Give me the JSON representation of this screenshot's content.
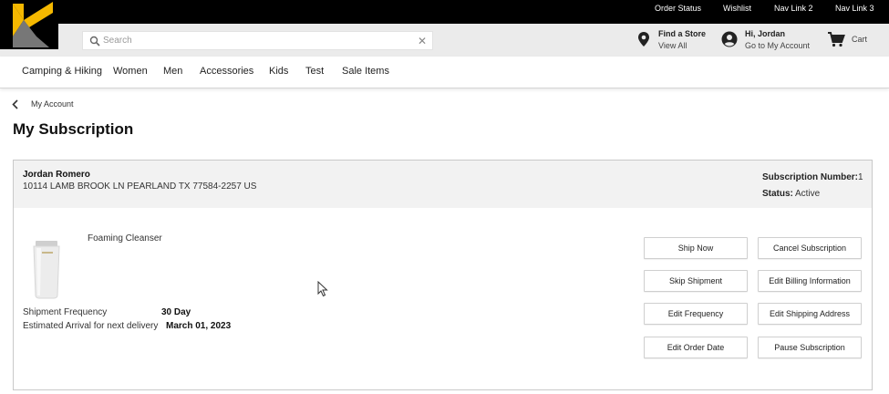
{
  "topnav": {
    "links": [
      "Order Status",
      "Wishlist",
      "Nav Link 2",
      "Nav Link 3"
    ]
  },
  "brand": {
    "colors": {
      "accent": "#f5b800",
      "logo_gray": "#777777",
      "topbar": "#000000",
      "header_bg": "#ebebeb"
    }
  },
  "search": {
    "placeholder": "Search",
    "value": "",
    "icon": "search-icon",
    "clear_icon": "close-icon",
    "clear_glyph": "✕"
  },
  "header": {
    "store": {
      "title": "Find a Store",
      "subtitle": "View All",
      "icon": "location-pin-icon"
    },
    "account": {
      "title": "Hi, Jordan",
      "subtitle": "Go to My Account",
      "icon": "user-icon"
    },
    "cart": {
      "label": "Cart",
      "icon": "cart-icon"
    }
  },
  "categories": [
    "Camping & Hiking",
    "Women",
    "Men",
    "Accessories",
    "Kids",
    "Test",
    "Sale Items"
  ],
  "breadcrumb": {
    "label": "My Account",
    "icon": "chevron-left-icon"
  },
  "page": {
    "title": "My Subscription"
  },
  "subscription": {
    "customer_name": "Jordan Romero",
    "address": "10114 LAMB BROOK LN PEARLAND TX 77584-2257 US",
    "number_label": "Subscription Number:",
    "number": "1",
    "status_label": "Status:",
    "status": "Active",
    "product_name": "Foaming Cleanser",
    "frequency_label": "Shipment Frequency",
    "frequency": "30 Day",
    "arrival_label": "Estimated Arrival for next delivery",
    "arrival": "March 01, 2023"
  },
  "actions": {
    "ship_now": "Ship Now",
    "cancel": "Cancel Subscription",
    "skip": "Skip Shipment",
    "edit_billing": "Edit Billing Information",
    "edit_frequency": "Edit Frequency",
    "edit_shipping": "Edit Shipping Address",
    "edit_order_date": "Edit Order Date",
    "pause": "Pause Subscription"
  }
}
